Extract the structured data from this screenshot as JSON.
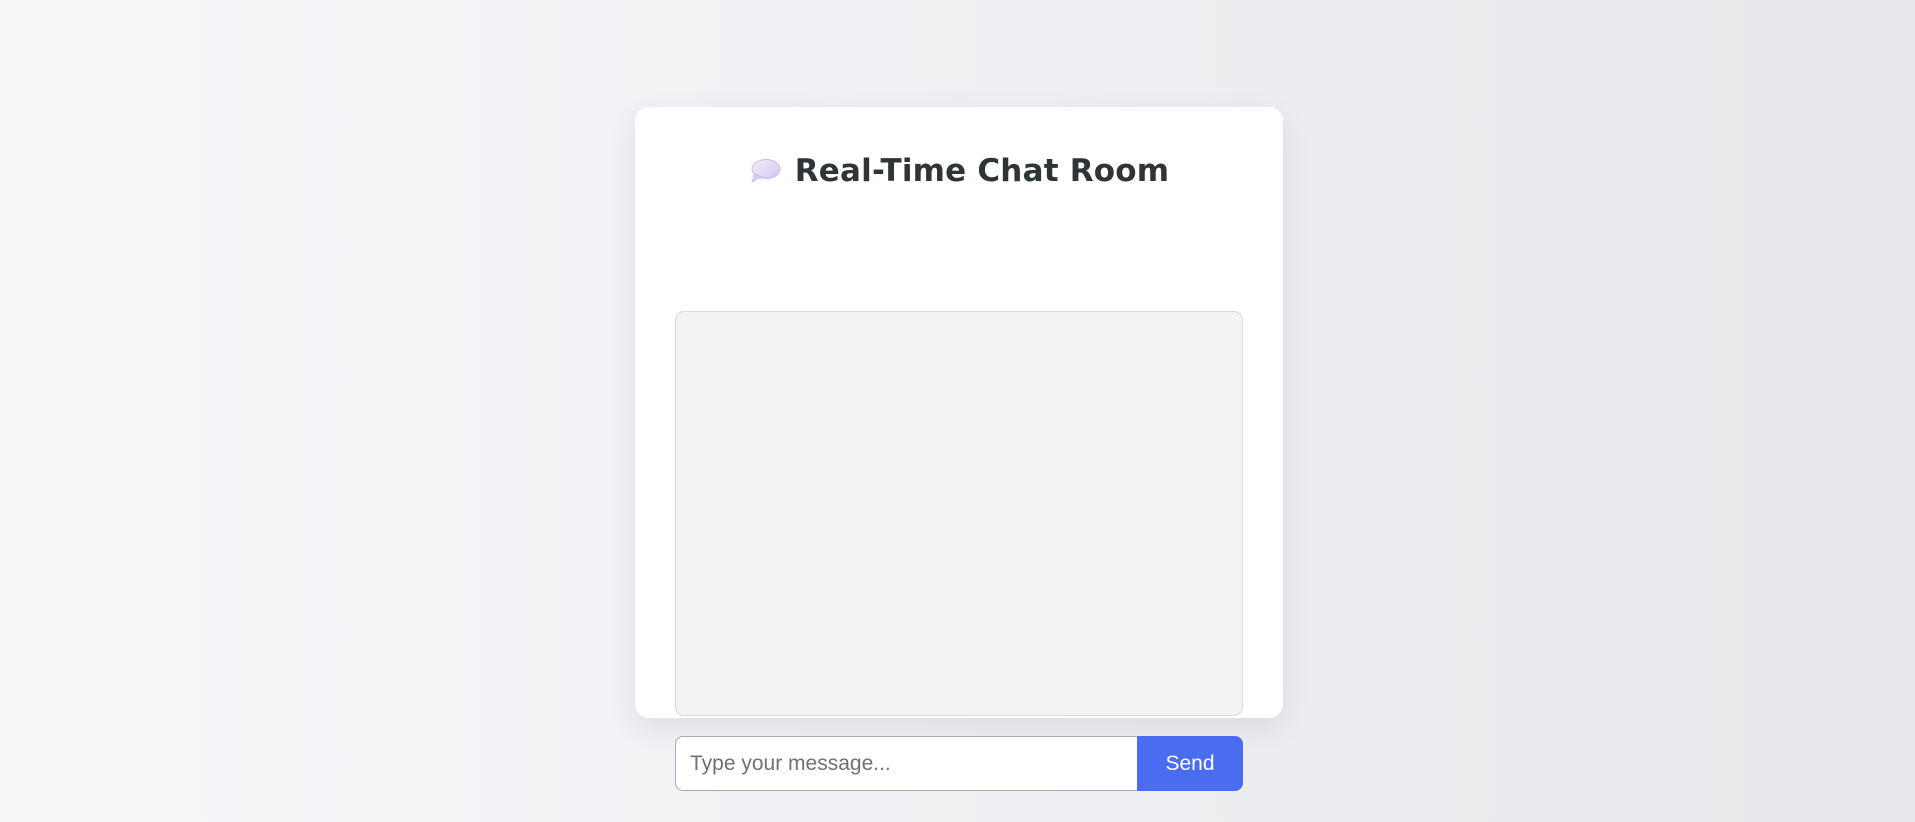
{
  "header": {
    "title": "Real-Time Chat Room",
    "icon": "speech-bubble-icon"
  },
  "chat": {
    "messages": []
  },
  "composer": {
    "placeholder": "Type your message...",
    "value": "",
    "send_label": "Send"
  },
  "colors": {
    "accent": "#4a6cf0",
    "title": "#2f3436",
    "chat_area": "#f2f3f5",
    "card": "#ffffff"
  }
}
